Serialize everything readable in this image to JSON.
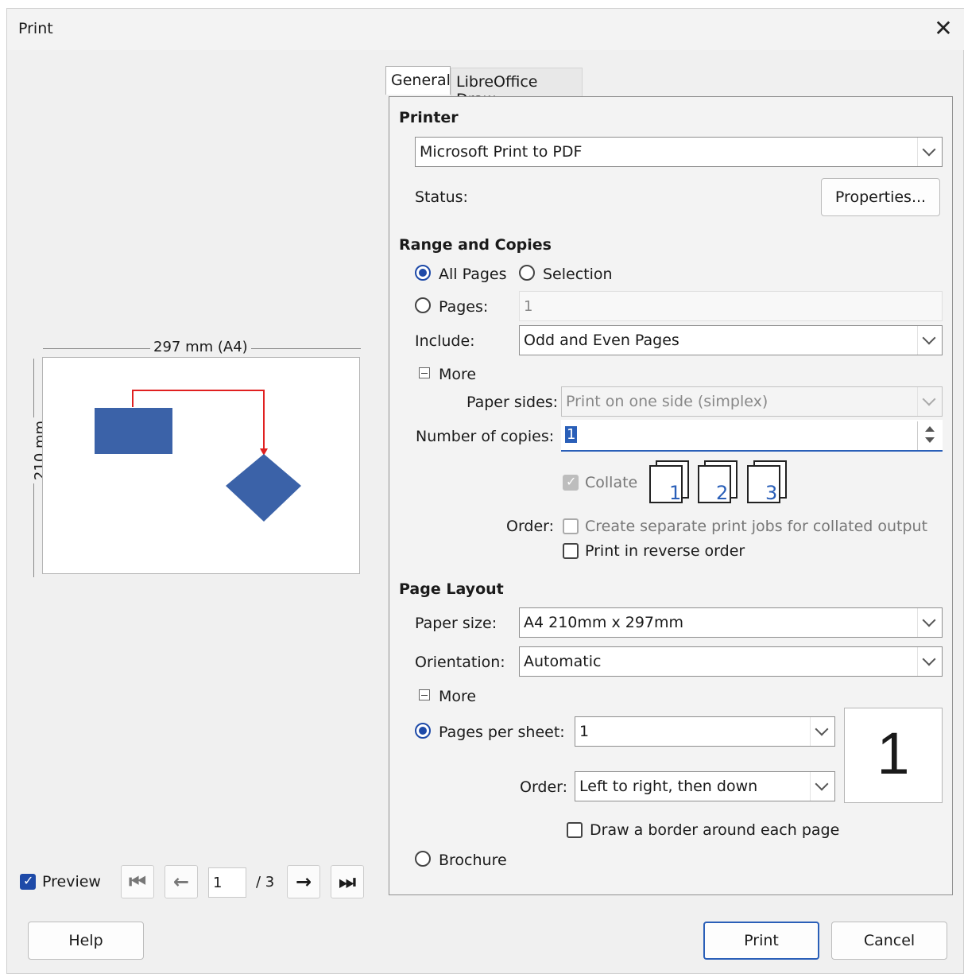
{
  "window": {
    "title": "Print"
  },
  "tabs": [
    "General",
    "LibreOffice Draw"
  ],
  "printer": {
    "heading": "Printer",
    "selected": "Microsoft Print to PDF",
    "status_label": "Status:",
    "properties_button": "Properties..."
  },
  "range": {
    "heading": "Range and Copies",
    "all_pages": "All Pages",
    "selection": "Selection",
    "pages": "Pages:",
    "pages_value": "1",
    "include_label": "Include:",
    "include_value": "Odd and Even Pages",
    "more": "More",
    "paper_sides_label": "Paper sides:",
    "paper_sides_value": "Print on one side (simplex)",
    "copies_label": "Number of copies:",
    "copies_value": "1",
    "collate": "Collate",
    "collate_icons": [
      "1",
      "2",
      "3"
    ],
    "order_label": "Order:",
    "separate_jobs": "Create separate print jobs for collated output",
    "reverse_order": "Print in reverse order"
  },
  "layout": {
    "heading": "Page Layout",
    "paper_size_label": "Paper size:",
    "paper_size_value": "A4 210mm x 297mm",
    "orientation_label": "Orientation:",
    "orientation_value": "Automatic",
    "more": "More",
    "pages_per_sheet": "Pages per sheet:",
    "pages_per_sheet_value": "1",
    "order_label": "Order:",
    "order_value": "Left to right, then down",
    "preview_number": "1",
    "draw_border": "Draw a border around each page",
    "brochure": "Brochure"
  },
  "preview": {
    "width_label": "297 mm (A4)",
    "height_label": "210 mm",
    "checkbox_label": "Preview",
    "current_page": "1",
    "total_pages": "/ 3",
    "shape_colors": {
      "fill": "#3b62a8",
      "connector": "#e02020"
    }
  },
  "buttons": {
    "help": "Help",
    "print": "Print",
    "cancel": "Cancel"
  }
}
